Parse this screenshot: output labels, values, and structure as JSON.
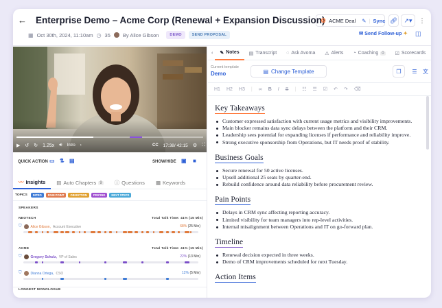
{
  "header": {
    "title": "Enterprise Demo – Acme Corp (Renewal + Expansion Discussion)",
    "date": "Oct 30th, 2024, 11:10am",
    "duration": "35",
    "author": "By Alice Gibson",
    "tags": [
      "DEMO",
      "SEND PROPOSAL"
    ],
    "deal_label": "ACME Deal",
    "sync_label": "Sync",
    "follow_up_label": "Send Follow-up"
  },
  "video": {
    "speed": "1.25x",
    "chapter": "Intro",
    "time": "17:38/ 42:15",
    "progress": 0.41
  },
  "quick_action": {
    "label": "QUICK ACTION",
    "show_hide_label": "SHOW/HIDE"
  },
  "left_tabs": [
    {
      "label": "Insights"
    },
    {
      "label": "Auto Chapters",
      "badge": "9"
    },
    {
      "label": "Questions"
    },
    {
      "label": "Keywords"
    }
  ],
  "topics": {
    "label": "TOPICS",
    "chips": [
      {
        "label": "INTRO",
        "color": "#3e7bd6"
      },
      {
        "label": "PAIN POINT",
        "color": "#e07a4f"
      },
      {
        "label": "OBJECTION",
        "color": "#e0a030"
      },
      {
        "label": "PRICING",
        "color": "#a04fd0"
      },
      {
        "label": "NEXT STEPS",
        "color": "#4aa8d8"
      }
    ]
  },
  "speakers": {
    "label": "SPEAKERS",
    "groups": [
      {
        "company": "NEOTECH",
        "total": "Total Talk Time: 41% (15 Min)",
        "people": [
          {
            "name": "Alice Gibson,",
            "role": "Account Executive",
            "pct": "68%",
            "min": "(25 Min)",
            "color": "#e0793a",
            "name_color": "#e0793a",
            "fraction": 0.68
          }
        ]
      },
      {
        "company": "ACME",
        "total": "Total Talk Time: 41% (15 Min)",
        "people": [
          {
            "name": "Gregory Schulz,",
            "role": "VP of Sales",
            "pct": "22%",
            "min": "(13 Min)",
            "color": "#7b4fc8",
            "name_color": "#7b4fc8",
            "fraction": 0.22
          },
          {
            "name": "Dianna Ortega,",
            "role": "CSO",
            "pct": "12%",
            "min": "(5 Min)",
            "color": "#3e7bd6",
            "name_color": "#3e7bd6",
            "fraction": 0.12
          }
        ]
      }
    ]
  },
  "longest_monologue_label": "LONGEST MONOLOGUE",
  "right_tabs": [
    {
      "label": "Notes"
    },
    {
      "label": "Transcript"
    },
    {
      "label": "Ask Avoma"
    },
    {
      "label": "Alerts"
    },
    {
      "label": "Coaching",
      "badge": "0"
    },
    {
      "label": "Scorecards"
    }
  ],
  "template": {
    "label": "Current template",
    "value": "Demo",
    "change_label": "Change Template"
  },
  "toolbar": [
    "H1",
    "H2",
    "H3"
  ],
  "notes": [
    {
      "heading": "Key Takeaways",
      "underline": "#ff7a3d",
      "items": [
        "Customer expressed satisfaction with current usage metrics and visibility improvements.",
        "Main blocker remains data sync delays between the platform and their CRM.",
        "Leadership sees potential for expanding licenses if performance and reliability improve.",
        "Strong executive sponsorship from Operations, but IT needs proof of stability."
      ]
    },
    {
      "heading": "Business Goals",
      "underline": "#2d5fd6",
      "items": [
        "Secure renewal for 50 active licenses.",
        "Upsell additional 25 seats by quarter-end.",
        "Rebuild confidence around data reliability before procurement review."
      ]
    },
    {
      "heading": "Pain Points",
      "underline": "#2d5fd6",
      "items": [
        "Delays in CRM sync affecting reporting accuracy.",
        "Limited visibility for team managers into rep-level activities.",
        "Internal misalignment between Operations and IT on go-forward plan."
      ]
    },
    {
      "heading": "Timeline",
      "underline": "#7b4fc8",
      "items": [
        "Renewal decision expected in three weeks.",
        "Demo of CRM improvements scheduled for next Tuesday."
      ]
    },
    {
      "heading": "Action Items",
      "underline": "#2d5fd6",
      "items": []
    }
  ]
}
